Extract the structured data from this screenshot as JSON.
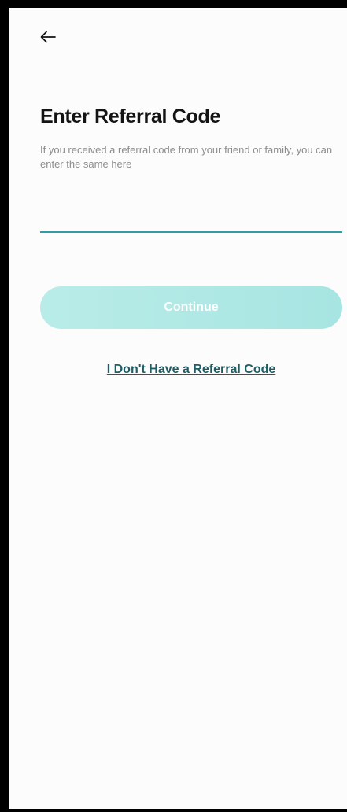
{
  "header": {
    "back_icon": "arrow-left-icon"
  },
  "content": {
    "title": "Enter Referral Code",
    "subtitle": "If you received a referral code from your friend or family, you can enter the same here",
    "input": {
      "value": "",
      "placeholder": ""
    },
    "continue_label": "Continue",
    "no_code_link": "I Don't Have a Referral Code"
  },
  "colors": {
    "accent": "#2c9ea4",
    "button_bg": "#b9ece8",
    "link": "#1f5e64",
    "title": "#141414",
    "subtitle": "#8d8d8d"
  }
}
